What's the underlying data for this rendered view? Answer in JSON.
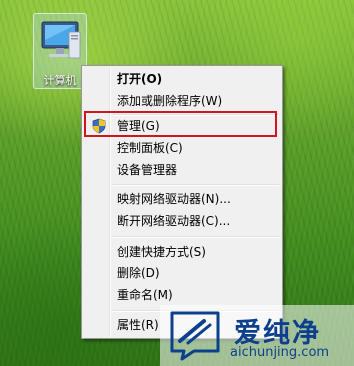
{
  "desktop": {
    "icon": {
      "label": "计算机",
      "icon": "computer-icon"
    }
  },
  "context_menu": {
    "items": [
      {
        "label": "打开(O)",
        "bold": true
      },
      {
        "label": "添加或删除程序(W)"
      },
      {
        "label": "管理(G)",
        "icon": "uac-shield-icon",
        "highlighted": true
      },
      {
        "label": "控制面板(C)"
      },
      {
        "label": "设备管理器"
      },
      {
        "label": "映射网络驱动器(N)..."
      },
      {
        "label": "断开网络驱动器(C)..."
      },
      {
        "label": "创建快捷方式(S)"
      },
      {
        "label": "删除(D)"
      },
      {
        "label": "重命名(M)"
      },
      {
        "label": "属性(R)"
      }
    ],
    "highlight_color": "#d2141e"
  },
  "watermark": {
    "name": "爱纯净",
    "url": "aichunjing.com",
    "color": "#0c3f8c"
  }
}
